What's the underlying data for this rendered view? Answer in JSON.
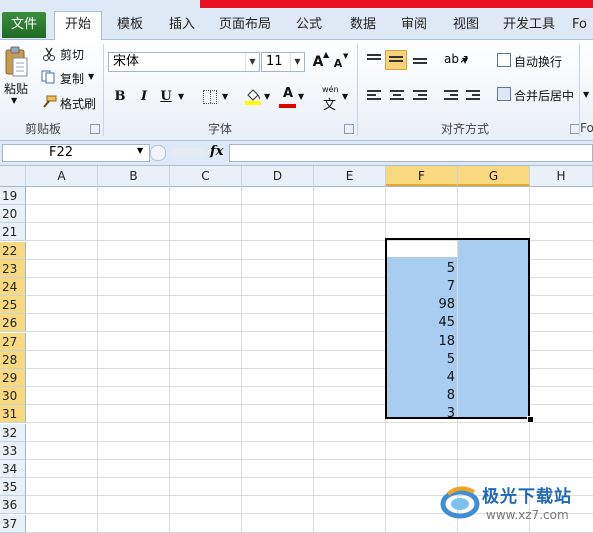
{
  "tabs": [
    "文件",
    "开始",
    "模板",
    "插入",
    "页面布局",
    "公式",
    "数据",
    "审阅",
    "视图",
    "开发工具"
  ],
  "tab_overflow": "Fo",
  "active_tab": "开始",
  "clipboard": {
    "paste_label": "粘贴",
    "cut_label": "剪切",
    "copy_label": "复制",
    "format_painter_label": "格式刷",
    "group_label": "剪贴板"
  },
  "font": {
    "font_name": "宋体",
    "font_size": "11",
    "grow_label": "A",
    "shrink_label": "A",
    "bold": "B",
    "italic": "I",
    "underline": "U",
    "font_color_label": "A",
    "phonetic_top": "wén",
    "phonetic_bottom": "文",
    "group_label": "字体"
  },
  "alignment": {
    "wrap_text_label": "自动换行",
    "merge_center_label": "合并后居中",
    "group_label": "对齐方式"
  },
  "formula_bar": {
    "name_box": "F22",
    "fx_label": "fx",
    "formula": ""
  },
  "columns": [
    "A",
    "B",
    "C",
    "D",
    "E",
    "F",
    "G",
    "H"
  ],
  "selected_columns": [
    "F",
    "G"
  ],
  "rows": [
    "19",
    "20",
    "21",
    "22",
    "23",
    "24",
    "25",
    "26",
    "27",
    "28",
    "29",
    "30",
    "31",
    "32",
    "33",
    "34",
    "35",
    "36",
    "37"
  ],
  "selected_rows": [
    "22",
    "23",
    "24",
    "25",
    "26",
    "27",
    "28",
    "29",
    "30",
    "31"
  ],
  "cells_F": [
    "",
    "5",
    "7",
    "98",
    "45",
    "18",
    "5",
    "4",
    "8",
    "3"
  ],
  "watermark": {
    "title": "极光下载站",
    "url": "www.xz7.com"
  },
  "colors": {
    "file_tab": "#2b7a30",
    "selection_fill": "#a8cdf0",
    "selected_header": "#f9d97f",
    "red_bar": "#e81123"
  }
}
